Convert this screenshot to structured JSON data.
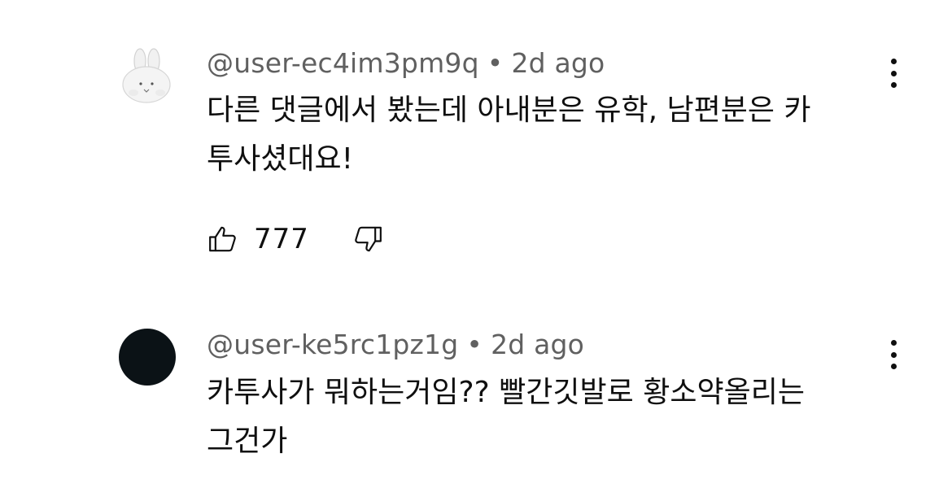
{
  "comments": [
    {
      "username": "@user-ec4im3pm9q",
      "separator": "•",
      "timestamp": "2d ago",
      "text": "다른 댓글에서 봤는데 아내분은 유학, 남편분은 카\n투사셨대요!",
      "like_count": "777",
      "avatar": "bunny-plush-avatar"
    },
    {
      "username": "@user-ke5rc1pz1g",
      "separator": "•",
      "timestamp": "2d ago",
      "text": "카투사가 뭐하는거임?? 빨간깃발로 황소약올리는\n그건가",
      "avatar": "dark-circle-avatar",
      "avatar_color": "#0b1216"
    }
  ],
  "icons": {
    "like": "thumbs-up-icon",
    "dislike": "thumbs-down-icon",
    "menu": "more-vertical-icon"
  }
}
